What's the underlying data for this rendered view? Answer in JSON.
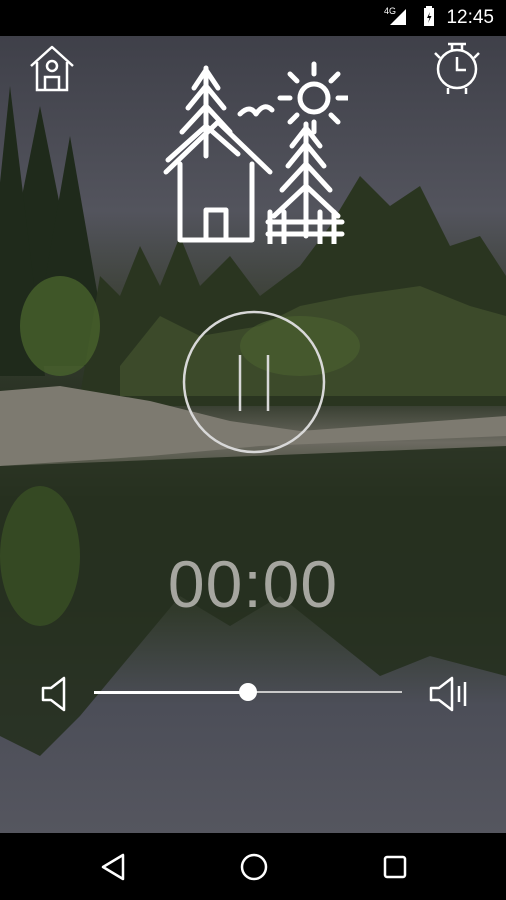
{
  "status_bar": {
    "network": "4G",
    "time": "12:45"
  },
  "player": {
    "timer": "00:00",
    "state": "paused",
    "volume_fraction": 0.5
  },
  "icons": {
    "home": "home-icon",
    "timer": "alarm-clock-icon",
    "logo": "cabin-forest-logo",
    "pause": "pause-icon",
    "volume_low": "volume-low-icon",
    "volume_high": "volume-high-icon",
    "nav_back": "back-icon",
    "nav_home": "home-circle-icon",
    "nav_recent": "recent-apps-icon"
  },
  "colors": {
    "accent": "#ffffff",
    "timer_text": "#a6a6a0"
  }
}
